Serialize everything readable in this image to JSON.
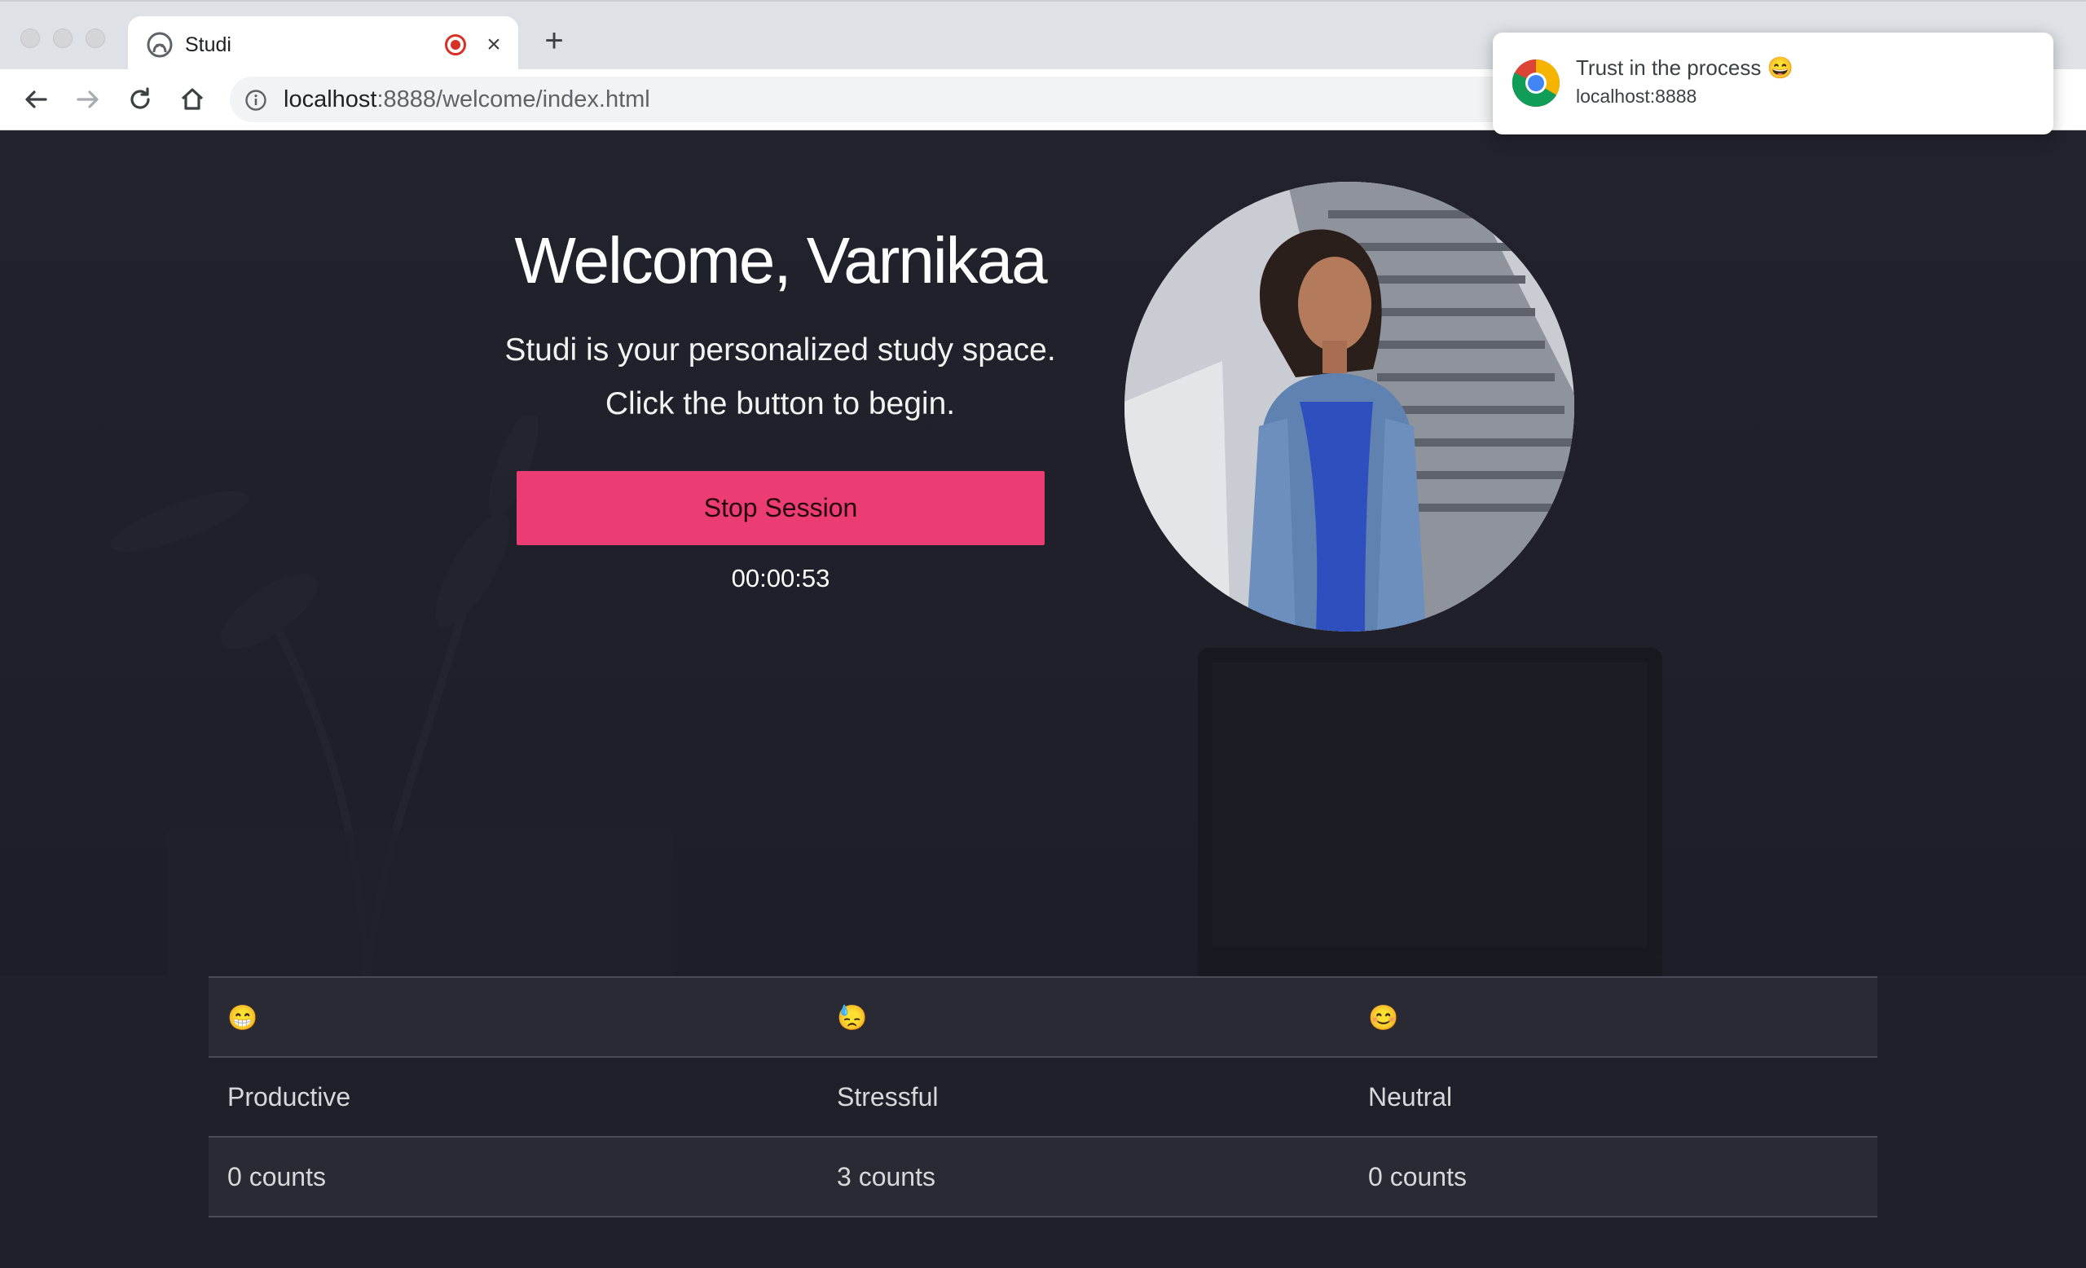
{
  "browser": {
    "tab_title": "Studi",
    "new_tab_label": "+",
    "close_tab_label": "×",
    "url_host": "localhost",
    "url_path": ":8888/welcome/index.html"
  },
  "notification": {
    "title": "Trust in the process 😄",
    "source": "localhost:8888"
  },
  "hero": {
    "title": "Welcome, Varnikaa",
    "subtitle_line1": "Studi is your personalized study space.",
    "subtitle_line2": "Click the button to begin.",
    "button_label": "Stop Session",
    "timer": "00:00:53"
  },
  "moods": {
    "emojis": [
      "😁",
      "😓",
      "😊"
    ],
    "labels": [
      "Productive",
      "Stressful",
      "Neutral"
    ],
    "counts": [
      "0 counts",
      "3 counts",
      "0 counts"
    ]
  },
  "colors": {
    "accent": "#ec3c74",
    "page_background": "#20202b",
    "table_row_alt": "#2a2a35"
  }
}
